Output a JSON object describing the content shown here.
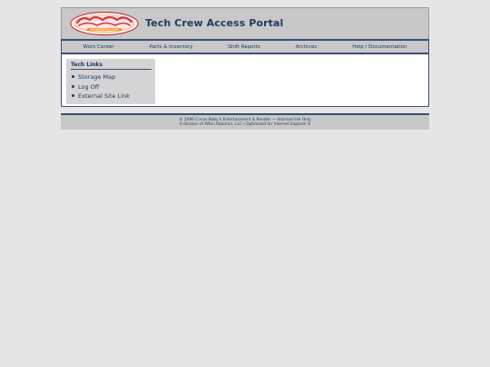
{
  "header": {
    "logo_alt": "Circus Baby's Entertainment & Rentals",
    "title": "Tech Crew Access Portal"
  },
  "nav": {
    "items": [
      "Work Center",
      "Parts & Inventory",
      "Shift Reports",
      "Archives",
      "Help / Documentation"
    ]
  },
  "sidebar": {
    "title": "Tech Links",
    "items": [
      "Storage Map",
      "Log Off",
      "External Site Link"
    ]
  },
  "footer": {
    "line1": "© 2006 Circus Baby's Entertainment & Rentals — Internal Use Only",
    "line2": "A division of Afton Robotics, LLC | Optimized for Internet Explorer 6"
  },
  "colors": {
    "background": "#e6e6e6",
    "panel": "#c8c8c8",
    "accent": "#3a4f73",
    "text": "#1f3a60",
    "logo_red": "#d9333f",
    "logo_orange": "#f08a2a"
  }
}
